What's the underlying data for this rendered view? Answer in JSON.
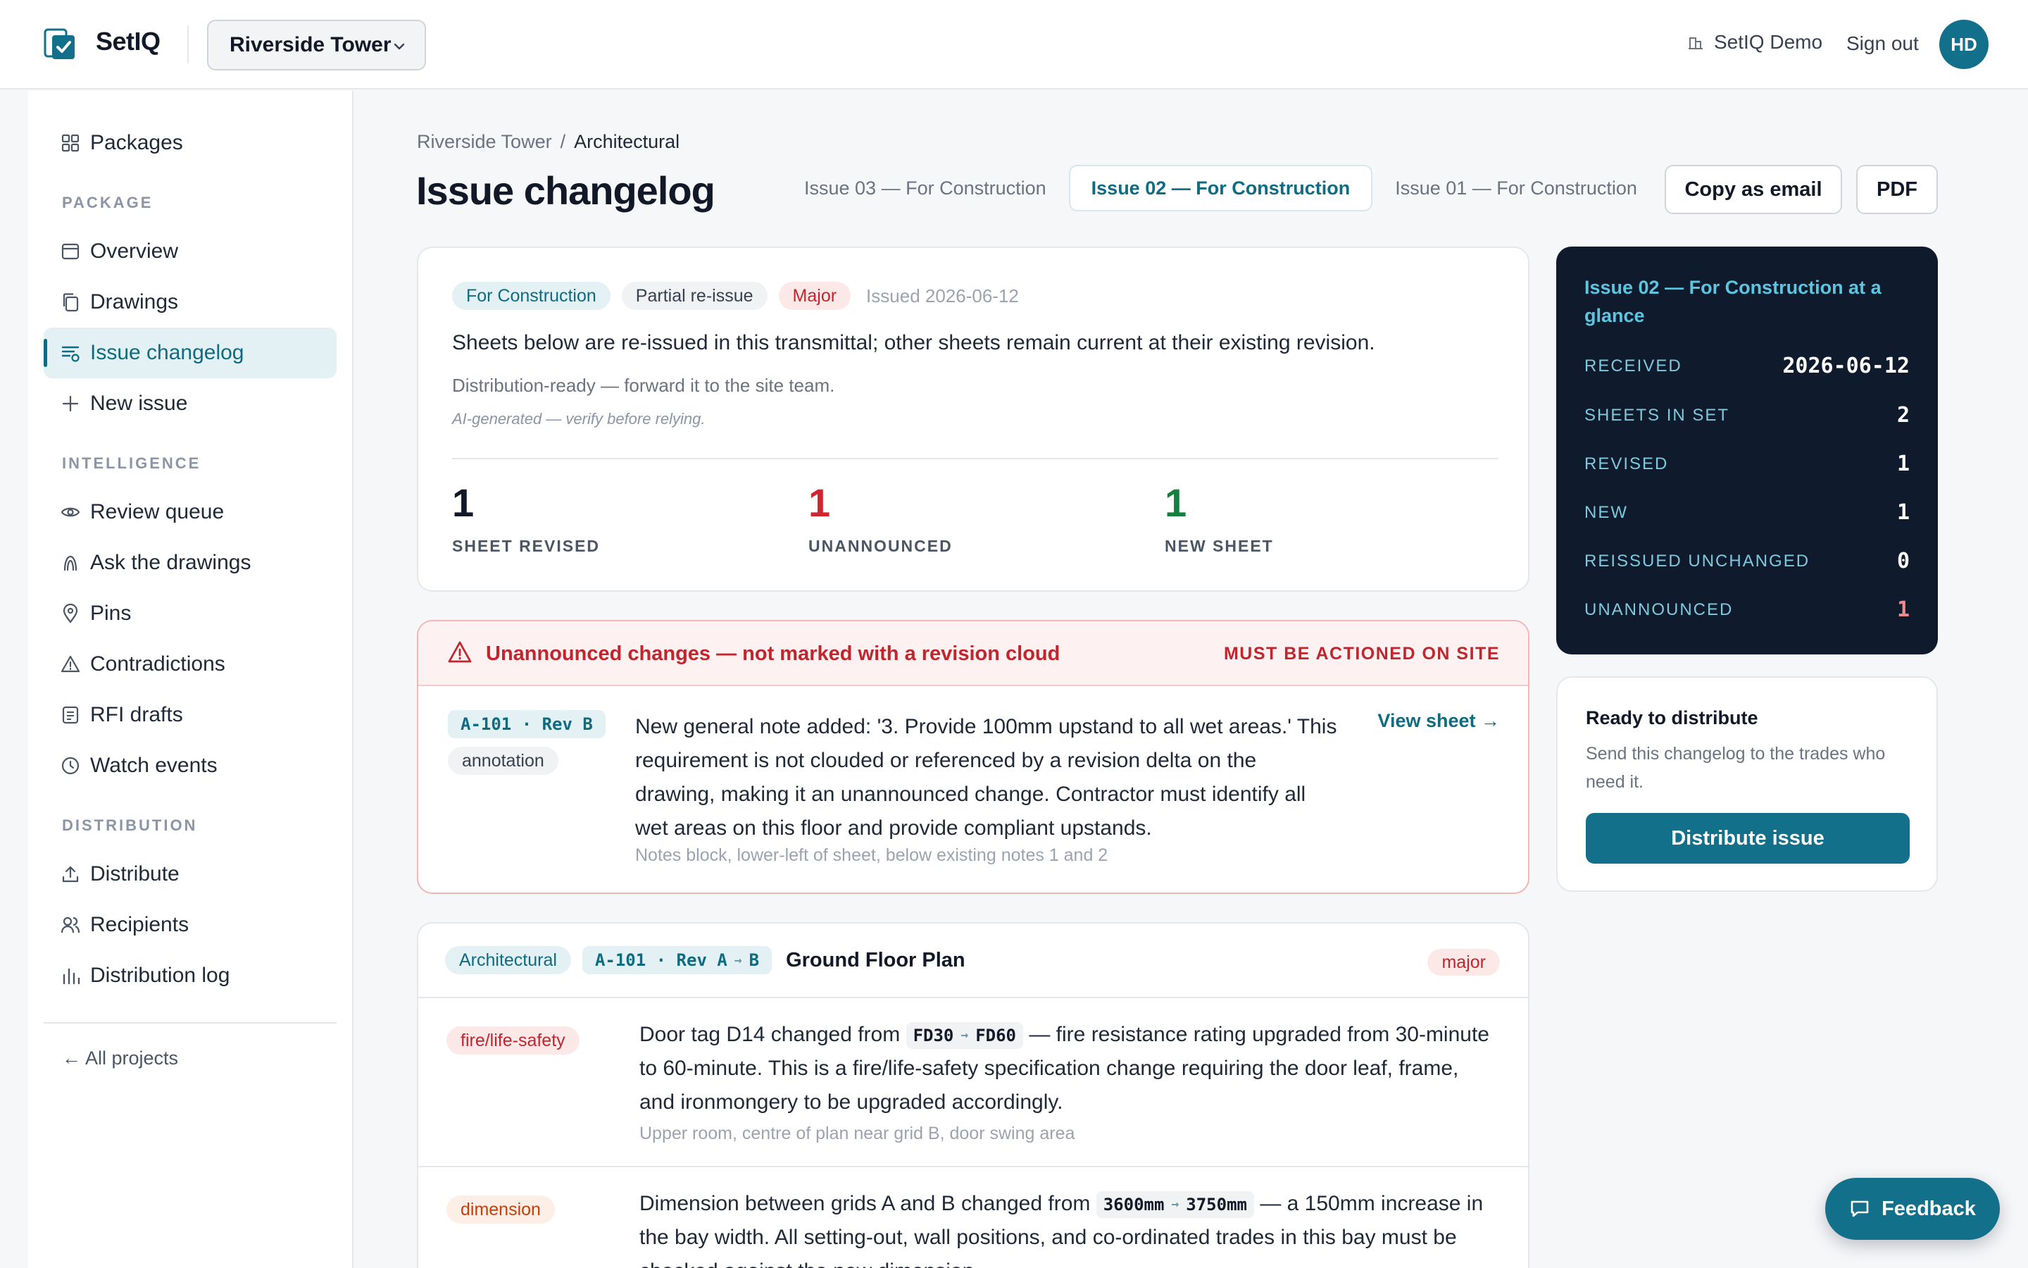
{
  "app": {
    "name": "SetIQ",
    "project": "Riverside Tower",
    "account": "SetIQ Demo",
    "sign_out": "Sign out",
    "avatar_initials": "HD"
  },
  "sidebar": {
    "top_item": "Packages",
    "sections": [
      {
        "title": "PACKAGE",
        "items": [
          "Overview",
          "Drawings",
          "Issue changelog",
          "New issue"
        ]
      },
      {
        "title": "INTELLIGENCE",
        "items": [
          "Review queue",
          "Ask the drawings",
          "Pins",
          "Contradictions",
          "RFI drafts",
          "Watch events"
        ]
      },
      {
        "title": "DISTRIBUTION",
        "items": [
          "Distribute",
          "Recipients",
          "Distribution log"
        ]
      }
    ],
    "active_item": "Issue changelog",
    "all_projects": "← All projects"
  },
  "breadcrumb": {
    "project": "Riverside Tower",
    "separator": "/",
    "current": "Architectural"
  },
  "page_title": "Issue changelog",
  "issue_tabs": [
    "Issue 03 — For Construction",
    "Issue 02 — For Construction",
    "Issue 01 — For Construction"
  ],
  "active_issue_tab": "Issue 02 — For Construction",
  "actions": {
    "copy_email": "Copy as email",
    "pdf": "PDF"
  },
  "summary": {
    "badges": [
      "For Construction",
      "Partial re-issue",
      "Major"
    ],
    "issued": "Issued 2026-06-12",
    "description": "Sheets below are re-issued in this transmittal; other sheets remain current at their existing revision.",
    "sub": "Distribution-ready — forward it to the site team.",
    "ai_note": "AI-generated — verify before relying.",
    "stats": [
      {
        "value": "1",
        "label": "SHEET REVISED",
        "color": "#111827"
      },
      {
        "value": "1",
        "label": "UNANNOUNCED",
        "color": "#d1242f"
      },
      {
        "value": "1",
        "label": "NEW SHEET",
        "color": "#15803d"
      }
    ]
  },
  "unannounced": {
    "title": "Unannounced changes — not marked with a revision cloud",
    "tag": "MUST BE ACTIONED ON SITE",
    "sheet_code": "A-101 · Rev B",
    "kind": "annotation",
    "text": "New general note added: '3. Provide 100mm upstand to all wet areas.' This requirement is not clouded or referenced by a revision delta on the drawing, making it an unannounced change. Contractor must identify all wet areas on this floor and provide compliant upstands.",
    "location": "Notes block, lower-left of sheet, below existing notes 1 and 2",
    "view_link": "View sheet →"
  },
  "sheet_card": {
    "discipline": "Architectural",
    "sheet": "A-101 · Rev A",
    "rev_to": "B",
    "title": "Ground Floor Plan",
    "severity": "major",
    "changes": [
      {
        "category": "fire/life-safety",
        "prefix": "Door tag D14 changed from",
        "from": "FD30",
        "to": "FD60",
        "suffix": "— fire resistance rating upgraded from 30-minute to 60-minute. This is a fire/life-safety specification change requiring the door leaf, frame, and ironmongery to be upgraded accordingly.",
        "location": "Upper room, centre of plan near grid B, door swing area"
      },
      {
        "category": "dimension",
        "prefix": "Dimension between grids A and B changed from",
        "from": "3600mm",
        "to": "3750mm",
        "suffix": "— a 150mm increase in the bay width. All setting-out, wall positions, and co-ordinated trades in this bay must be checked against the new dimension.",
        "location": ""
      }
    ]
  },
  "glance": {
    "title": "Issue 02 — For Construction at a glance",
    "rows": [
      {
        "key": "RECEIVED",
        "value": "2026-06-12"
      },
      {
        "key": "SHEETS IN SET",
        "value": "2"
      },
      {
        "key": "REVISED",
        "value": "1"
      },
      {
        "key": "NEW",
        "value": "1"
      },
      {
        "key": "REISSUED UNCHANGED",
        "value": "0"
      },
      {
        "key": "UNANNOUNCED",
        "value": "1"
      }
    ]
  },
  "ready": {
    "title": "Ready to distribute",
    "sub": "Send this changelog to the trades who need it.",
    "button": "Distribute issue"
  },
  "feedback": "Feedback",
  "arrow_glyph": "→"
}
